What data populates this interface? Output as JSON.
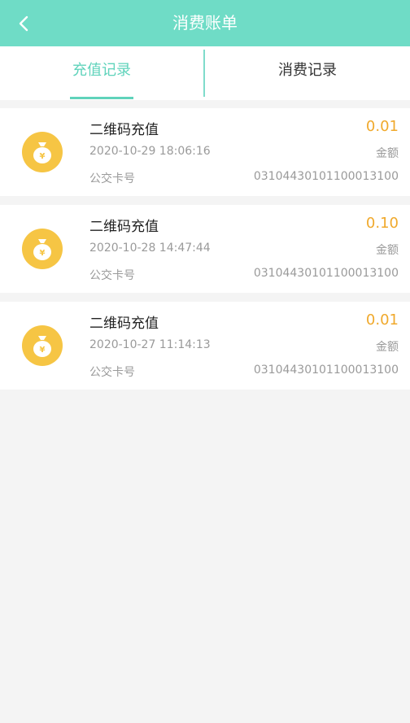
{
  "header": {
    "title": "消费账单",
    "back_icon": "chevron-left-icon",
    "background_color": "#6fdcc6"
  },
  "tabs": [
    {
      "label": "充值记录",
      "active": true
    },
    {
      "label": "消费记录",
      "active": false
    }
  ],
  "accent_color": "#5fd3bb",
  "amount_color": "#f0a92c",
  "records": [
    {
      "title": "二维码充值",
      "amount": "0.01",
      "time": "2020-10-29 18:06:16",
      "amount_label": "金额",
      "card_label": "公交卡号",
      "card_no": "0310443010110001310​0",
      "icon": "money-bag-icon"
    },
    {
      "title": "二维码充值",
      "amount": "0.10",
      "time": "2020-10-28 14:47:44",
      "amount_label": "金额",
      "card_label": "公交卡号",
      "card_no": "03104430101100013100",
      "icon": "money-bag-icon"
    },
    {
      "title": "二维码充值",
      "amount": "0.01",
      "time": "2020-10-27 11:14:13",
      "amount_label": "金额",
      "card_label": "公交卡号",
      "card_no": "03104430101100013100",
      "icon": "money-bag-icon"
    }
  ]
}
